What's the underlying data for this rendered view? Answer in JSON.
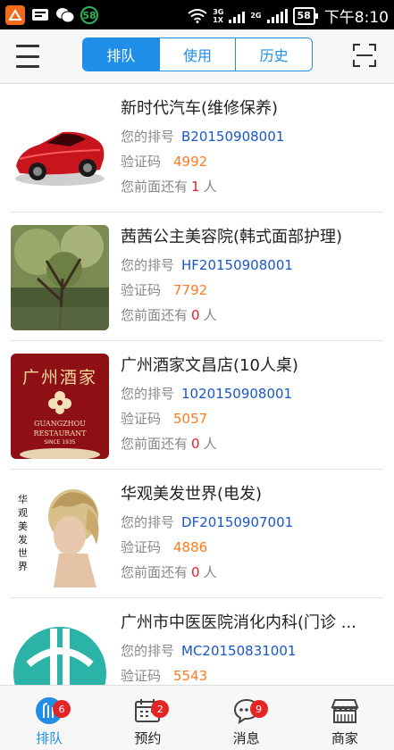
{
  "status_bar": {
    "notification_count": "58",
    "network_top": "3G",
    "network_bottom": "1X",
    "network_small": "2G",
    "battery": "58",
    "time": "下午8:10"
  },
  "header": {
    "tabs": [
      {
        "label": "排队",
        "active": true
      },
      {
        "label": "使用",
        "active": false
      },
      {
        "label": "历史",
        "active": false
      }
    ]
  },
  "list": {
    "field_labels": {
      "number": "您的排号",
      "code": "验证码",
      "ahead_prefix": "您前面还有",
      "ahead_suffix": "人"
    },
    "items": [
      {
        "name": "新时代汽车(维修保养)",
        "queue_no": "B20150908001",
        "code": "4992",
        "ahead": "1"
      },
      {
        "name": "茜茜公主美容院(韩式面部护理)",
        "queue_no": "HF20150908001",
        "code": "7792",
        "ahead": "0"
      },
      {
        "name": "广州酒家文昌店(10人桌)",
        "queue_no": "1020150908001",
        "code": "5057",
        "ahead": "0"
      },
      {
        "name": "华观美发世界(电发)",
        "queue_no": "DF20150907001",
        "code": "4886",
        "ahead": "0"
      },
      {
        "name": "广州市中医医院消化内科(门诊 ...",
        "queue_no": "MC20150831001",
        "code": "5543",
        "ahead": ""
      }
    ],
    "restaurant_logo": {
      "chinese": "广州酒家",
      "english_1": "GUANGZHOU",
      "english_2": "RESTAURANT",
      "since": "SINCE 1935"
    },
    "salon_logo_text": "华观美发世界"
  },
  "bottom_nav": [
    {
      "label": "排队",
      "badge": "6",
      "icon": "queue-icon"
    },
    {
      "label": "预约",
      "badge": "2",
      "icon": "calendar-icon"
    },
    {
      "label": "消息",
      "badge": "9",
      "icon": "message-icon"
    },
    {
      "label": "商家",
      "badge": "",
      "icon": "shop-icon"
    }
  ],
  "colors": {
    "accent": "#1e8ee8",
    "queue_no": "#1a56c8",
    "code": "#ff7a1f",
    "ahead": "#e02020",
    "badge": "#e52525"
  }
}
